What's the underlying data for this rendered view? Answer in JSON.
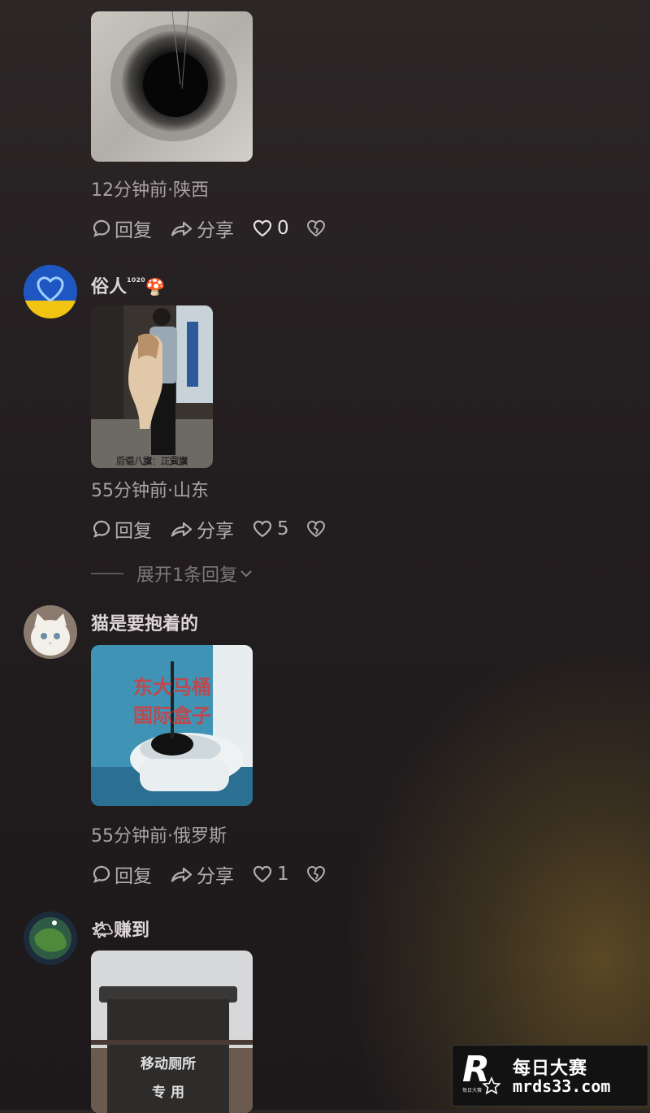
{
  "comments": [
    {
      "image_desc": "hole",
      "meta": "12分钟前·陕西",
      "reply_label": "回复",
      "share_label": "分享",
      "likes": "0"
    },
    {
      "username": "俗人",
      "username_sup": "¹⁰²⁰",
      "username_emoji": "🍄",
      "image_caption": "后语八旗：正黄旗",
      "meta": "55分钟前·山东",
      "reply_label": "回复",
      "share_label": "分享",
      "likes": "5",
      "expand_label": "展开1条回复"
    },
    {
      "username": "猫是要抱着的",
      "image_text_line1": "东大马桶",
      "image_text_line2": "国际盒子",
      "meta": "55分钟前·俄罗斯",
      "reply_label": "回复",
      "share_label": "分享",
      "likes": "1"
    },
    {
      "username_emoji": "🌤",
      "username": "赚到",
      "image_text_line1": "移动厕所",
      "image_text_line2": "专 用"
    }
  ],
  "watermark": {
    "logo": "R",
    "logo_sub": "每日大赛",
    "title": "每日大赛",
    "url": "mrds33.com"
  },
  "colors": {
    "background_top": "#2c2627",
    "background_glow": "#5a4824",
    "text_primary": "#ddd6d6",
    "text_meta": "#a8a2a2"
  }
}
